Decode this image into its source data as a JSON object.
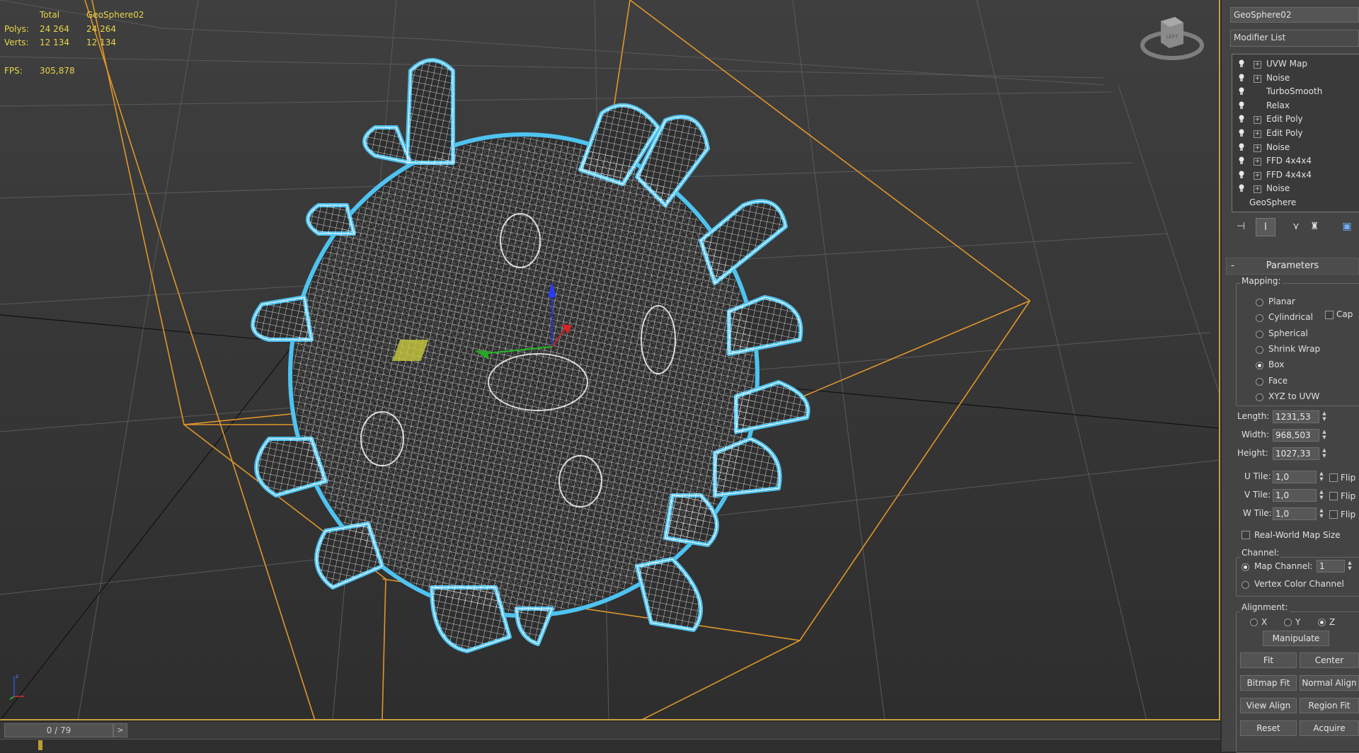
{
  "stats": {
    "header_total": "Total",
    "header_object": "GeoSphere02",
    "polys_label": "Polys:",
    "polys_total": "24 264",
    "polys_object": "24 264",
    "verts_label": "Verts:",
    "verts_total": "12 134",
    "verts_object": "12 134",
    "fps_label": "FPS:",
    "fps_value": "305,878"
  },
  "viewcube": {
    "face_label": "LEFT"
  },
  "timeline": {
    "frame": "0 / 79",
    "next": ">"
  },
  "panel": {
    "object_name": "GeoSphere02",
    "modifier_list": "Modifier List",
    "modifiers": [
      {
        "label": "UVW Map",
        "expandable": true
      },
      {
        "label": "Noise",
        "expandable": true
      },
      {
        "label": "TurboSmooth",
        "expandable": false
      },
      {
        "label": "Relax",
        "expandable": false
      },
      {
        "label": "Edit Poly",
        "expandable": true
      },
      {
        "label": "Edit Poly",
        "expandable": true
      },
      {
        "label": "Noise",
        "expandable": true
      },
      {
        "label": "FFD 4x4x4",
        "expandable": true
      },
      {
        "label": "FFD 4x4x4",
        "expandable": true
      },
      {
        "label": "Noise",
        "expandable": true
      }
    ],
    "base_object": "GeoSphere",
    "stack_icons": [
      "pin-stack-icon",
      "show-end-result-icon",
      "make-unique-icon",
      "remove-modifier-icon",
      "configure-sets-icon"
    ],
    "rollout": {
      "collapse": "-",
      "title": "Parameters",
      "mapping_label": "Mapping:",
      "mapping_options": [
        "Planar",
        "Cylindrical",
        "Spherical",
        "Shrink Wrap",
        "Box",
        "Face",
        "XYZ to UVW"
      ],
      "mapping_selected": "Box",
      "cap_label": "Cap",
      "length_label": "Length:",
      "length_value": "1231,53",
      "width_label": "Width:",
      "width_value": "968,503",
      "height_label": "Height:",
      "height_value": "1027,33",
      "utile_label": "U Tile:",
      "utile_value": "1,0",
      "vtile_label": "V Tile:",
      "vtile_value": "1,0",
      "wtile_label": "W Tile:",
      "wtile_value": "1,0",
      "flip_label": "Flip",
      "real_world_label": "Real-World Map Size",
      "channel_label": "Channel:",
      "map_channel_label": "Map Channel:",
      "map_channel_value": "1",
      "vertex_color_label": "Vertex Color Channel",
      "alignment_label": "Alignment:",
      "axis_x": "X",
      "axis_y": "Y",
      "axis_z": "Z",
      "axis_selected": "Z",
      "buttons": {
        "manipulate": "Manipulate",
        "fit": "Fit",
        "center": "Center",
        "bitmap_fit": "Bitmap Fit",
        "normal_align": "Normal Align",
        "view_align": "View Align",
        "region_fit": "Region Fit",
        "reset": "Reset",
        "acquire": "Acquire"
      }
    }
  },
  "colors": {
    "stats_text": "#e8d64a",
    "gizmo": "#e0962a",
    "wire": "#ffffff",
    "selection_glow": "#4fc3f0"
  }
}
